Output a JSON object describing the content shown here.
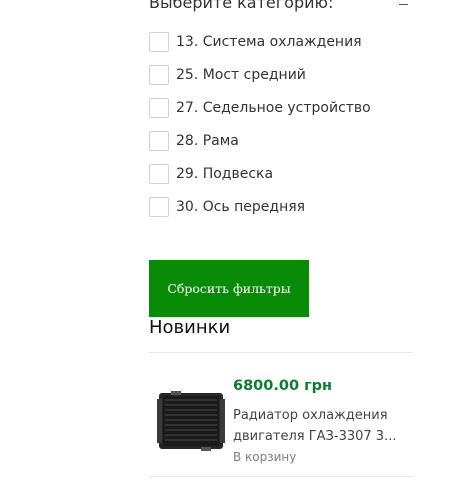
{
  "filter": {
    "title": "Выберите категорию:",
    "toggle_icon": "minus-icon",
    "categories": [
      {
        "label": "13. Система охлаждения",
        "checked": false
      },
      {
        "label": "25. Мост средний",
        "checked": false
      },
      {
        "label": "27. Седельное устройство",
        "checked": false
      },
      {
        "label": "28. Рама",
        "checked": false
      },
      {
        "label": "29. Подвеска",
        "checked": false
      },
      {
        "label": "30. Ось передняя",
        "checked": false
      }
    ],
    "reset_label": "Сбросить фильтры",
    "reset_color": "#088c08"
  },
  "new_products": {
    "title": "Новинки",
    "items": [
      {
        "price": "6800.00 грн",
        "name_line1": "Радиатор охлаждения",
        "name_line2": "двигателя ГАЗ-3307 3...",
        "cart_label": "В корзину",
        "image_icon": "radiator-image"
      }
    ],
    "price_color": "#0a7f2e"
  }
}
